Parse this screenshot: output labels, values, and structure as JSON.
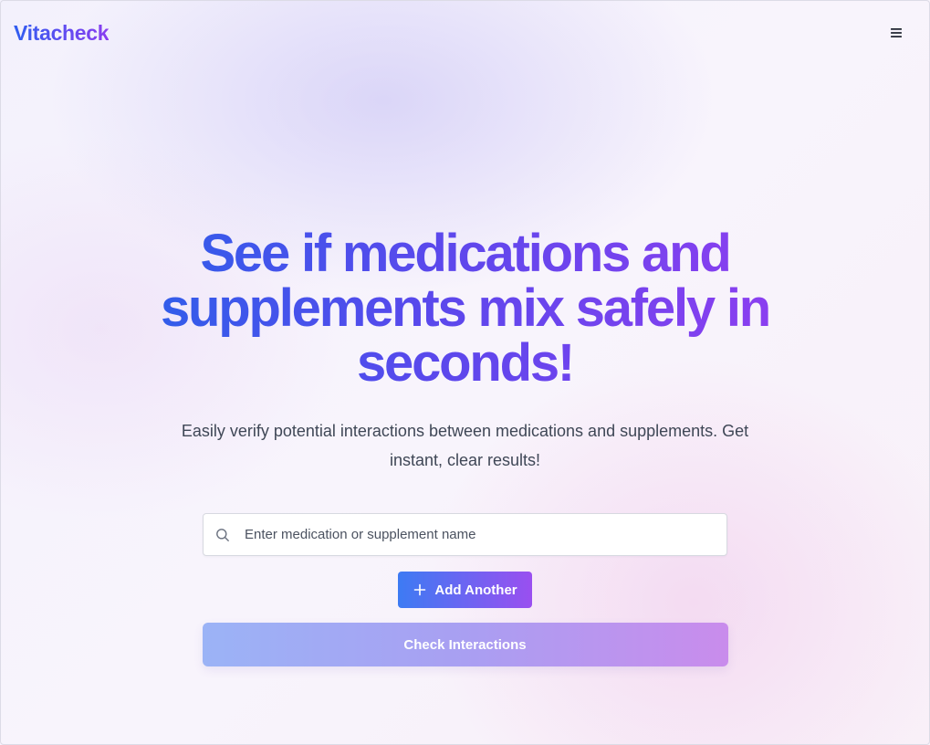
{
  "header": {
    "logo_text": "Vitacheck",
    "menu_icon": "hamburger-menu-icon"
  },
  "hero": {
    "headline": "See if medications and supplements mix safely in seconds!",
    "subtitle": "Easily verify potential interactions between medications and supplements. Get instant, clear results!"
  },
  "search": {
    "icon": "search-icon",
    "placeholder": "Enter medication or supplement name",
    "value": ""
  },
  "buttons": {
    "add_another_label": "Add Another",
    "add_icon": "plus-icon",
    "check_interactions_label": "Check Interactions"
  },
  "colors": {
    "brand_blue": "#2f5ef0",
    "brand_purple": "#8a3df0",
    "text_gray": "#3f4756"
  }
}
